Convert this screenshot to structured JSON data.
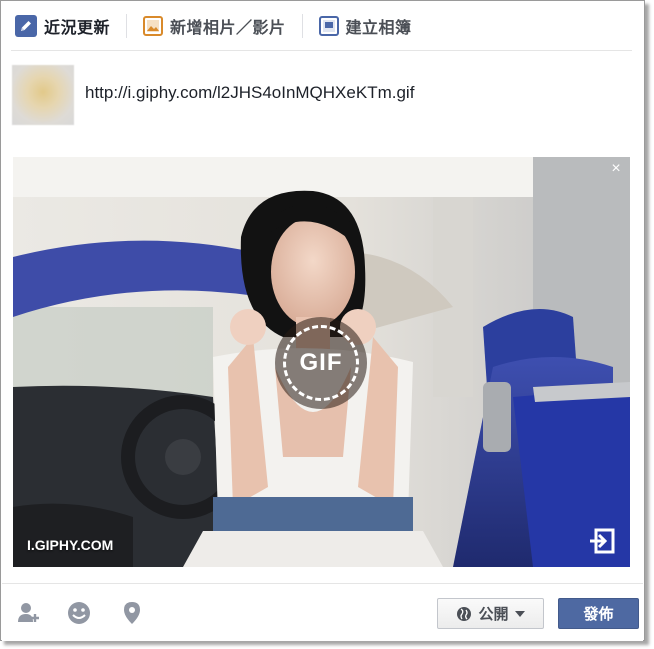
{
  "tabs": [
    {
      "label": "近況更新",
      "icon": "pencil-icon",
      "active": true
    },
    {
      "label": "新增相片／影片",
      "icon": "photo-icon",
      "active": false
    },
    {
      "label": "建立相簿",
      "icon": "album-icon",
      "active": false
    }
  ],
  "composer": {
    "text": "http://i.giphy.com/l2JHS4oInMQHXeKTm.gif"
  },
  "preview": {
    "badge_label": "GIF",
    "source_label": "I.GIPHY.COM",
    "close_symbol": "×"
  },
  "footer": {
    "icons": [
      "tag-friends-icon",
      "feeling-icon",
      "location-icon"
    ],
    "privacy_label": "公開",
    "post_label": "發佈"
  },
  "colors": {
    "accent": "#4e69a2",
    "photo_icon": "#d98a2b"
  }
}
